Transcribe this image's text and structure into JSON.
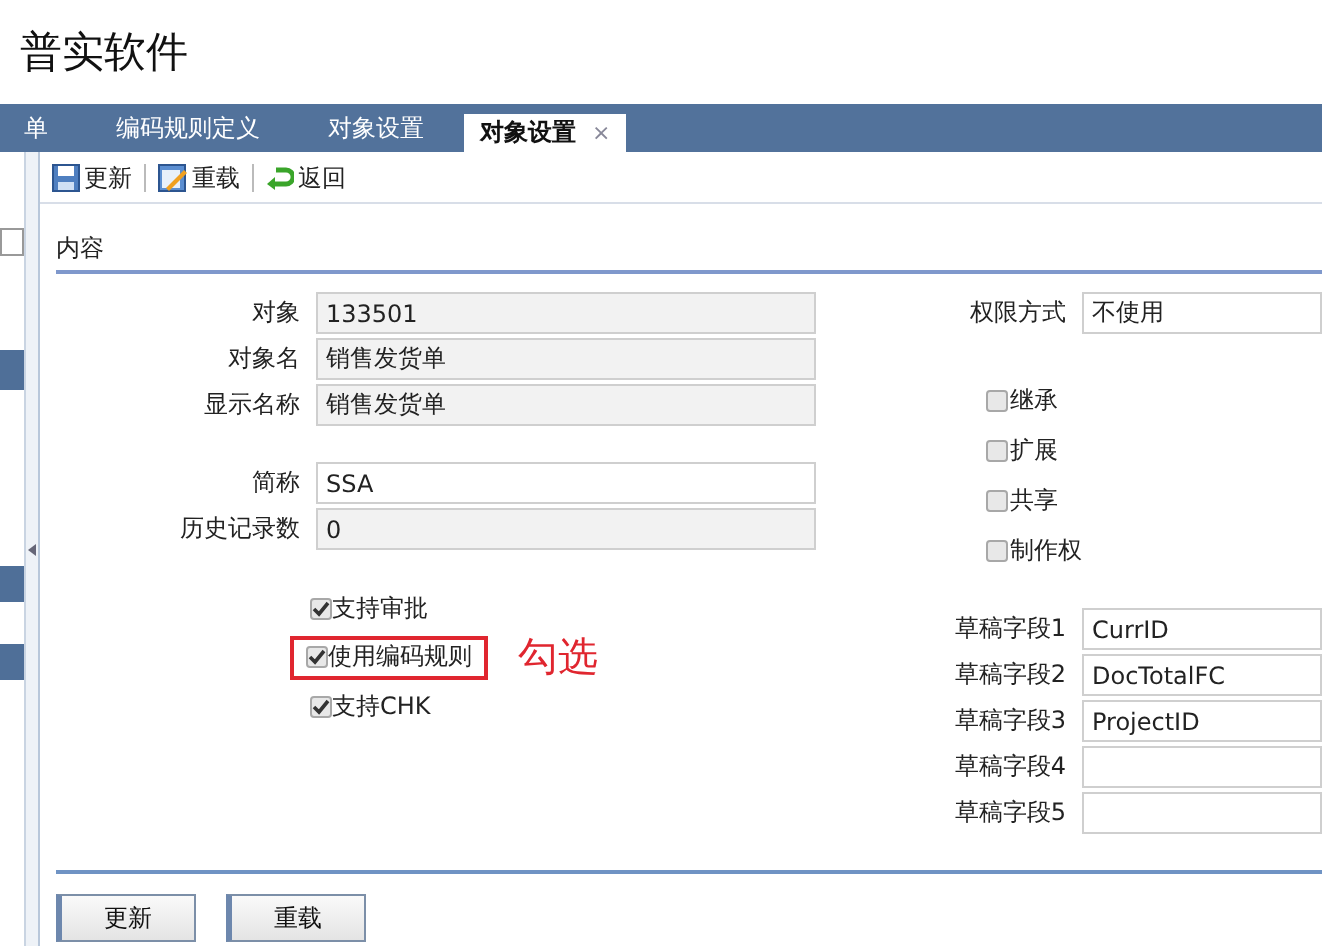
{
  "app": {
    "title": "普实软件"
  },
  "tabs": [
    {
      "label": "单",
      "selected": false
    },
    {
      "label": "编码规则定义",
      "selected": false
    },
    {
      "label": "对象设置",
      "selected": false
    },
    {
      "label": "对象设置",
      "selected": true,
      "close": "×"
    }
  ],
  "toolbar": [
    {
      "label": "更新",
      "kind": "save"
    },
    {
      "label": "重载",
      "kind": "reload"
    },
    {
      "label": "返回",
      "kind": "back"
    }
  ],
  "section": {
    "title": "内容"
  },
  "identity_fields": [
    {
      "label": "对象",
      "value": "133501",
      "readonly": true
    },
    {
      "label": "对象名",
      "value": "销售发货单",
      "readonly": true
    },
    {
      "label": "显示名称",
      "value": "销售发货单",
      "readonly": true
    }
  ],
  "extra_fields": [
    {
      "label": "简称",
      "value": "SSA",
      "readonly": false
    },
    {
      "label": "历史记录数",
      "value": "0",
      "readonly": true
    }
  ],
  "options": [
    {
      "label": "支持审批",
      "checked": true,
      "highlighted": false
    },
    {
      "label": "使用编码规则",
      "checked": true,
      "highlighted": true
    },
    {
      "label": "支持CHK",
      "checked": true,
      "highlighted": false
    }
  ],
  "annotation": {
    "text": "勾选"
  },
  "permission": {
    "label": "权限方式",
    "value": "不使用"
  },
  "flags": [
    {
      "label": "继承",
      "checked": false
    },
    {
      "label": "扩展",
      "checked": false
    },
    {
      "label": "共享",
      "checked": false
    },
    {
      "label": "制作权",
      "checked": false
    }
  ],
  "draft_fields": [
    {
      "label": "草稿字段1",
      "value": "CurrID"
    },
    {
      "label": "草稿字段2",
      "value": "DocTotalFC"
    },
    {
      "label": "草稿字段3",
      "value": "ProjectID"
    },
    {
      "label": "草稿字段4"
    },
    {
      "label": "草稿字段5"
    }
  ],
  "buttons": [
    {
      "label": "更新"
    },
    {
      "label": "重载"
    }
  ]
}
